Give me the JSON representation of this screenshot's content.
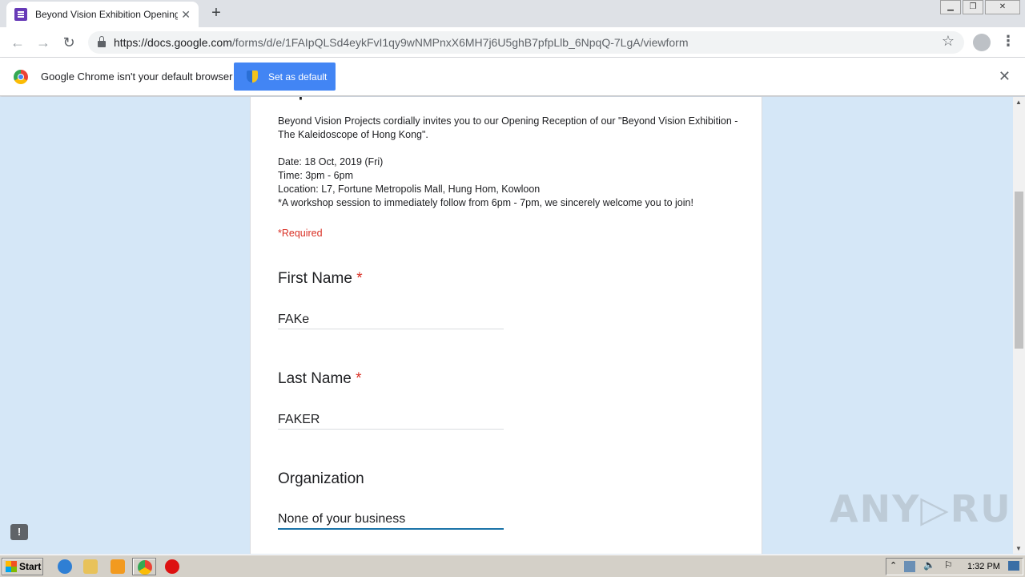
{
  "browser": {
    "tab_title": "Beyond Vision Exhibition Opening Re",
    "tab_close": "✕",
    "new_tab": "+",
    "url_host": "https://docs.google.com",
    "url_path": "/forms/d/e/1FAIpQLSd4eykFvI1qy9wNMPnxX6MH7j6U5ghB7pfpLlb_6NpqQ-7LgA/viewform",
    "back": "←",
    "forward": "→",
    "reload": "↻",
    "star": "☆",
    "menu": "⋮"
  },
  "infobar": {
    "message": "Google Chrome isn't your default browser",
    "button": "Set as default",
    "close": "✕"
  },
  "form": {
    "description_lines": [
      "Beyond Vision Projects cordially invites you to our Opening Reception of our \"Beyond Vision Exhibition - The Kaleidoscope of Hong Kong\".",
      "",
      "Date: 18 Oct, 2019 (Fri)",
      "Time: 3pm - 6pm",
      "Location: L7, Fortune Metropolis Mall, Hung Hom, Kowloon",
      "*A workshop session to immediately follow from 6pm - 7pm, we sincerely welcome you to join!"
    ],
    "required_note": "*Required",
    "questions": [
      {
        "label": "First Name",
        "required_mark": "*",
        "value": "FAKe"
      },
      {
        "label": "Last Name",
        "required_mark": "*",
        "value": "FAKER"
      },
      {
        "label": "Organization",
        "required_mark": "",
        "value": "None of your business"
      }
    ]
  },
  "feedback_icon": "!",
  "watermark": "ANY▷RUN",
  "taskbar": {
    "start": "Start",
    "clock": "1:32 PM"
  },
  "colors": {
    "page_bg": "#d5e7f7",
    "required_red": "#d93025",
    "focus_blue": "#1a73a8",
    "chrome_button": "#4285f4"
  }
}
